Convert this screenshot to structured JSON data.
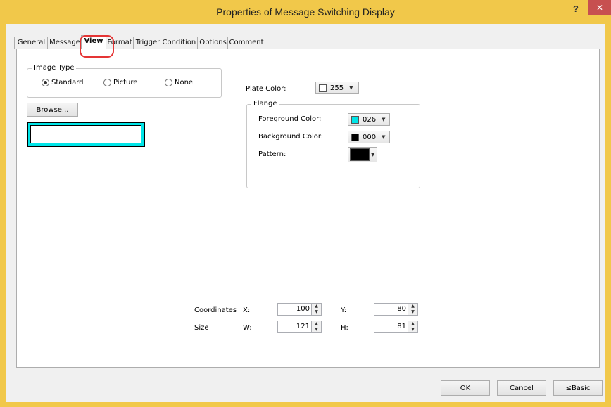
{
  "window": {
    "title": "Properties of Message Switching Display",
    "help_label": "?",
    "close_label": "✕"
  },
  "tabs": [
    "General",
    "Message",
    "View",
    "Format",
    "Trigger Condition",
    "Options",
    "Comment"
  ],
  "active_tab": "View",
  "image_type": {
    "group_label": "Image Type",
    "options": [
      {
        "label": "Standard",
        "selected": true
      },
      {
        "label": "Picture",
        "selected": false
      },
      {
        "label": "None",
        "selected": false
      }
    ]
  },
  "browse_label": "Browse...",
  "plate_color": {
    "label": "Plate Color:",
    "value": "255",
    "swatch": "#ffffff"
  },
  "flange": {
    "group_label": "Flange",
    "foreground": {
      "label": "Foreground Color:",
      "value": "026",
      "swatch": "#00e5e8"
    },
    "background": {
      "label": "Background Color:",
      "value": "000",
      "swatch": "#000000"
    },
    "pattern": {
      "label": "Pattern:",
      "swatch": "#000000"
    }
  },
  "coordinates": {
    "label": "Coordinates",
    "x_label": "X:",
    "x": "100",
    "y_label": "Y:",
    "y": "80"
  },
  "size": {
    "label": "Size",
    "w_label": "W:",
    "w": "121",
    "h_label": "H:",
    "h": "81"
  },
  "buttons": {
    "ok": "OK",
    "cancel": "Cancel",
    "basic": "≤Basic"
  },
  "colors": {
    "title_bar": "#f1c84a",
    "close": "#c75050",
    "highlight": "#e53535"
  }
}
